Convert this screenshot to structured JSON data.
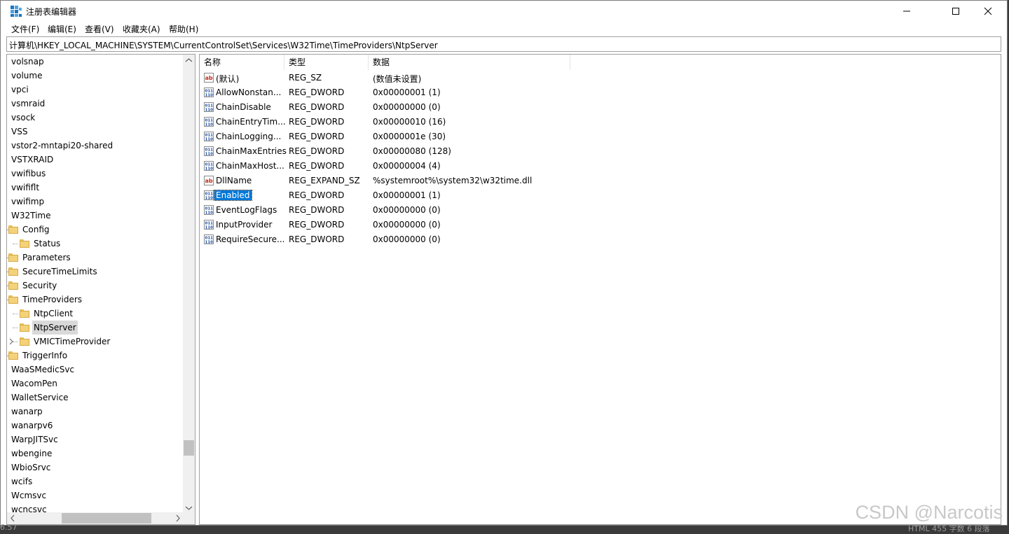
{
  "window": {
    "title": "注册表编辑器",
    "minimize_glyph": "—",
    "maximize_glyph": "☐",
    "close_glyph": "✕"
  },
  "menu": [
    "文件(F)",
    "编辑(E)",
    "查看(V)",
    "收藏夹(A)",
    "帮助(H)"
  ],
  "address": "计算机\\HKEY_LOCAL_MACHINE\\SYSTEM\\CurrentControlSet\\Services\\W32Time\\TimeProviders\\NtpServer",
  "tree": [
    {
      "label": "volsnap",
      "level": 0,
      "folder": false
    },
    {
      "label": "volume",
      "level": 0,
      "folder": false
    },
    {
      "label": "vpci",
      "level": 0,
      "folder": false
    },
    {
      "label": "vsmraid",
      "level": 0,
      "folder": false
    },
    {
      "label": "vsock",
      "level": 0,
      "folder": false
    },
    {
      "label": "VSS",
      "level": 0,
      "folder": false
    },
    {
      "label": "vstor2-mntapi20-shared",
      "level": 0,
      "folder": false
    },
    {
      "label": "VSTXRAID",
      "level": 0,
      "folder": false
    },
    {
      "label": "vwifibus",
      "level": 0,
      "folder": false
    },
    {
      "label": "vwififlt",
      "level": 0,
      "folder": false
    },
    {
      "label": "vwifimp",
      "level": 0,
      "folder": false
    },
    {
      "label": "W32Time",
      "level": 0,
      "folder": false
    },
    {
      "label": "Config",
      "level": 1,
      "folder": true
    },
    {
      "label": "Status",
      "level": 2,
      "folder": true
    },
    {
      "label": "Parameters",
      "level": 1,
      "folder": true
    },
    {
      "label": "SecureTimeLimits",
      "level": 1,
      "folder": true
    },
    {
      "label": "Security",
      "level": 1,
      "folder": true
    },
    {
      "label": "TimeProviders",
      "level": 1,
      "folder": true
    },
    {
      "label": "NtpClient",
      "level": 2,
      "folder": true
    },
    {
      "label": "NtpServer",
      "level": 2,
      "folder": true,
      "selected": true
    },
    {
      "label": "VMICTimeProvider",
      "level": 2,
      "folder": true,
      "expander": true
    },
    {
      "label": "TriggerInfo",
      "level": 1,
      "folder": true
    },
    {
      "label": "WaaSMedicSvc",
      "level": 0,
      "folder": false
    },
    {
      "label": "WacomPen",
      "level": 0,
      "folder": false
    },
    {
      "label": "WalletService",
      "level": 0,
      "folder": false
    },
    {
      "label": "wanarp",
      "level": 0,
      "folder": false
    },
    {
      "label": "wanarpv6",
      "level": 0,
      "folder": false
    },
    {
      "label": "WarpJITSvc",
      "level": 0,
      "folder": false
    },
    {
      "label": "wbengine",
      "level": 0,
      "folder": false
    },
    {
      "label": "WbioSrvc",
      "level": 0,
      "folder": false
    },
    {
      "label": "wcifs",
      "level": 0,
      "folder": false
    },
    {
      "label": "Wcmsvc",
      "level": 0,
      "folder": false
    },
    {
      "label": "wcncsvc",
      "level": 0,
      "folder": false
    }
  ],
  "columns": {
    "name": "名称",
    "type": "类型",
    "data": "数据"
  },
  "values": [
    {
      "name": "(默认)",
      "type": "REG_SZ",
      "data": "(数值未设置)",
      "icon": "string-value-icon"
    },
    {
      "name": "AllowNonstan...",
      "type": "REG_DWORD",
      "data": "0x00000001 (1)",
      "icon": "binary-value-icon"
    },
    {
      "name": "ChainDisable",
      "type": "REG_DWORD",
      "data": "0x00000000 (0)",
      "icon": "binary-value-icon"
    },
    {
      "name": "ChainEntryTim...",
      "type": "REG_DWORD",
      "data": "0x00000010 (16)",
      "icon": "binary-value-icon"
    },
    {
      "name": "ChainLogging...",
      "type": "REG_DWORD",
      "data": "0x0000001e (30)",
      "icon": "binary-value-icon"
    },
    {
      "name": "ChainMaxEntries",
      "type": "REG_DWORD",
      "data": "0x00000080 (128)",
      "icon": "binary-value-icon"
    },
    {
      "name": "ChainMaxHost...",
      "type": "REG_DWORD",
      "data": "0x00000004 (4)",
      "icon": "binary-value-icon"
    },
    {
      "name": "DllName",
      "type": "REG_EXPAND_SZ",
      "data": "%systemroot%\\system32\\w32time.dll",
      "icon": "string-value-icon"
    },
    {
      "name": "Enabled",
      "type": "REG_DWORD",
      "data": "0x00000001 (1)",
      "icon": "binary-value-icon",
      "selected": true
    },
    {
      "name": "EventLogFlags",
      "type": "REG_DWORD",
      "data": "0x00000000 (0)",
      "icon": "binary-value-icon"
    },
    {
      "name": "InputProvider",
      "type": "REG_DWORD",
      "data": "0x00000000 (0)",
      "icon": "binary-value-icon"
    },
    {
      "name": "RequireSecure...",
      "type": "REG_DWORD",
      "data": "0x00000000 (0)",
      "icon": "binary-value-icon"
    }
  ],
  "watermark": "CSDN @Narcotis",
  "background_fragments": {
    "left": "6.57",
    "right": "HTML  455 字数  6 段落"
  },
  "colors": {
    "selection": "#0078d7",
    "tree_selection": "#d9d9d9",
    "folder": "#f4d27a"
  }
}
